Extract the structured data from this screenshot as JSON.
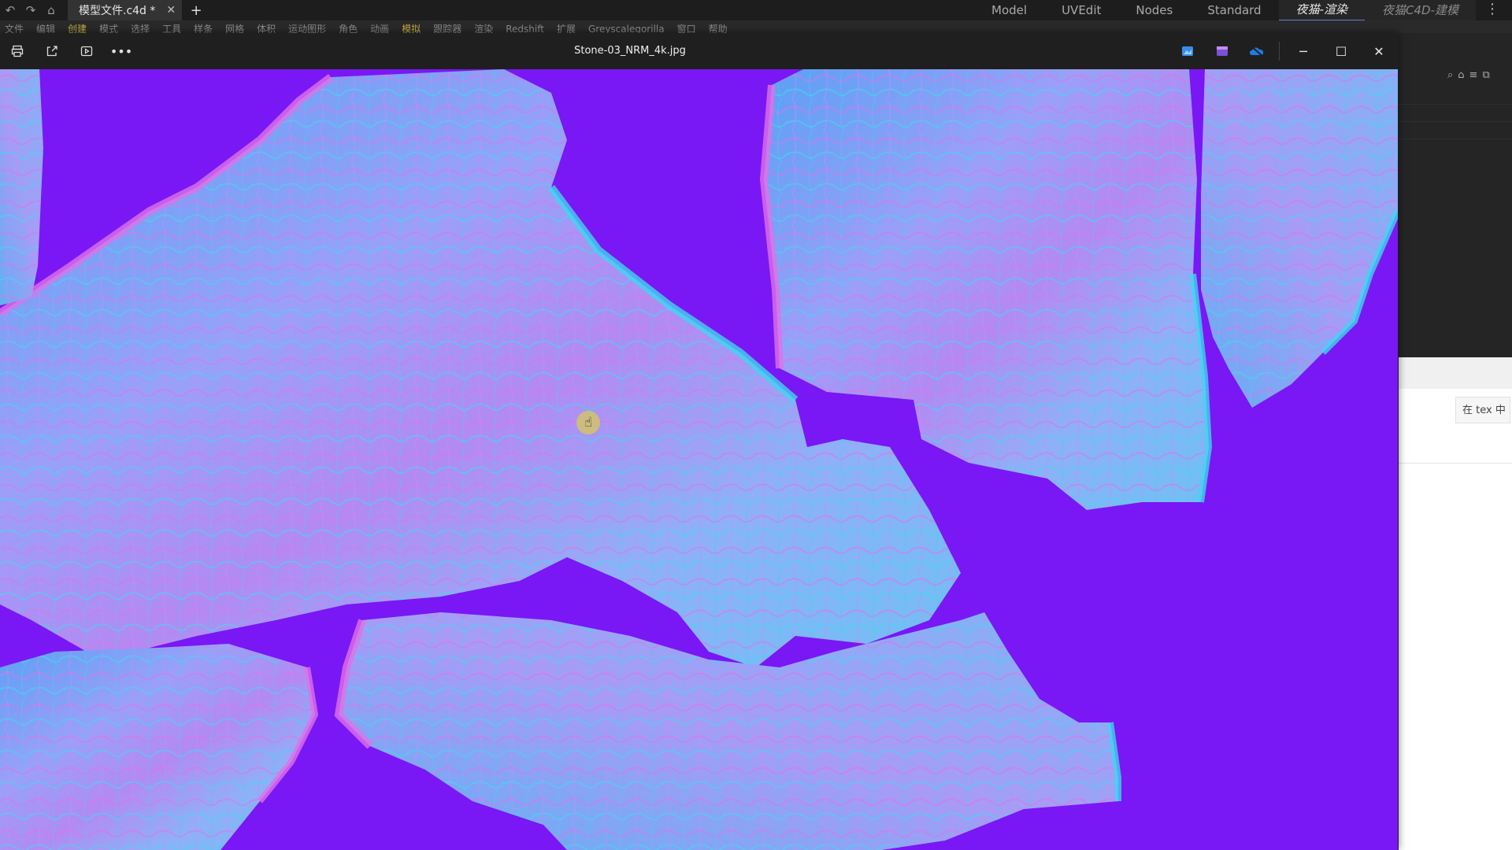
{
  "c4d": {
    "tab_title": "模型文件.c4d *",
    "layouts": [
      "Model",
      "UVEdit",
      "Nodes",
      "Standard",
      "夜猫-渲染",
      "夜猫C4D-建模"
    ],
    "active_layout_index": 4,
    "menu": [
      "文件",
      "编辑",
      "创建",
      "模式",
      "选择",
      "工具",
      "样条",
      "网格",
      "体积",
      "运动图形",
      "角色",
      "动画",
      "模拟",
      "跟踪器",
      "渲染",
      "Redshift",
      "扩展",
      "Greyscalegorilla",
      "窗口",
      "帮助"
    ],
    "right_panel_search": "在 tex 中"
  },
  "viewer": {
    "file_title": "Stone-03_NRM_4k.jpg",
    "background_color": "#7a17f5",
    "stone_gradient": [
      "#5aa0f5",
      "#9aa0f8",
      "#e070e8",
      "#40d8f0"
    ]
  },
  "icons": {
    "undo": "undo-icon",
    "redo": "redo-icon",
    "home": "home-icon",
    "print": "print-icon",
    "share": "share-icon",
    "slideshow": "slideshow-icon",
    "more": "more-icon",
    "hand": "hand-cursor-icon"
  }
}
